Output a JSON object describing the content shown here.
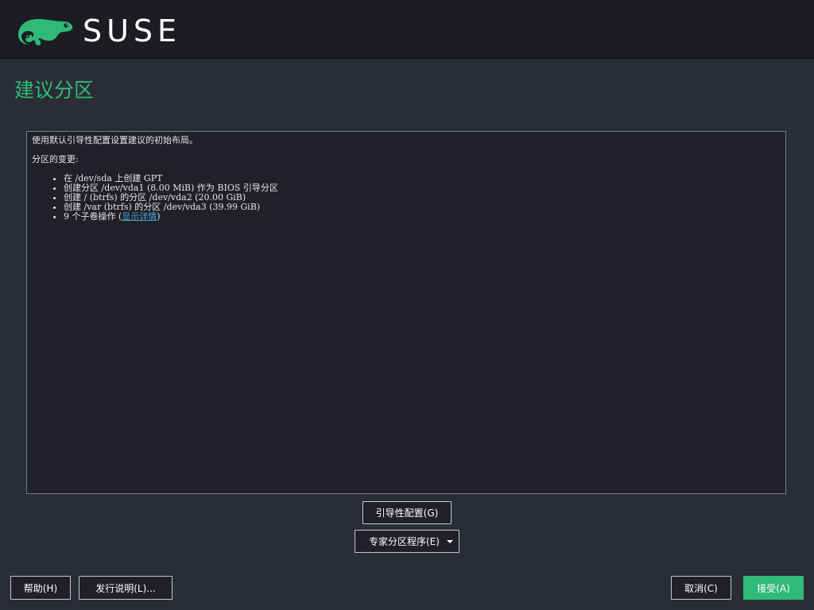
{
  "header": {
    "logo_icon": "chameleon-icon",
    "logo_text": "SUSE",
    "brand_color": "#30ba78"
  },
  "page": {
    "title": "建议分区"
  },
  "summary": {
    "intro": "使用默认引导性配置设置建议的初始布局。",
    "changes_heading": "分区的变更:",
    "items": [
      "在 /dev/sda 上创建 GPT",
      "创建分区 /dev/vda1 (8.00 MiB) 作为 BIOS 引导分区",
      "创建 / (btrfs) 的分区 /dev/vda2 (20.00 GiB)",
      "创建 /var (btrfs) 的分区 /dev/vda3 (39.99 GiB)"
    ],
    "last_item_prefix": "9 个子卷操作 (",
    "last_item_link": "显示详情",
    "last_item_suffix": ")"
  },
  "buttons": {
    "guided_setup": "引导性配置(G)",
    "expert_partitioner": "专家分区程序(E)",
    "help": "帮助(H)",
    "release_notes": "发行说明(L)...",
    "cancel": "取消(C)",
    "accept": "接受(A)"
  }
}
